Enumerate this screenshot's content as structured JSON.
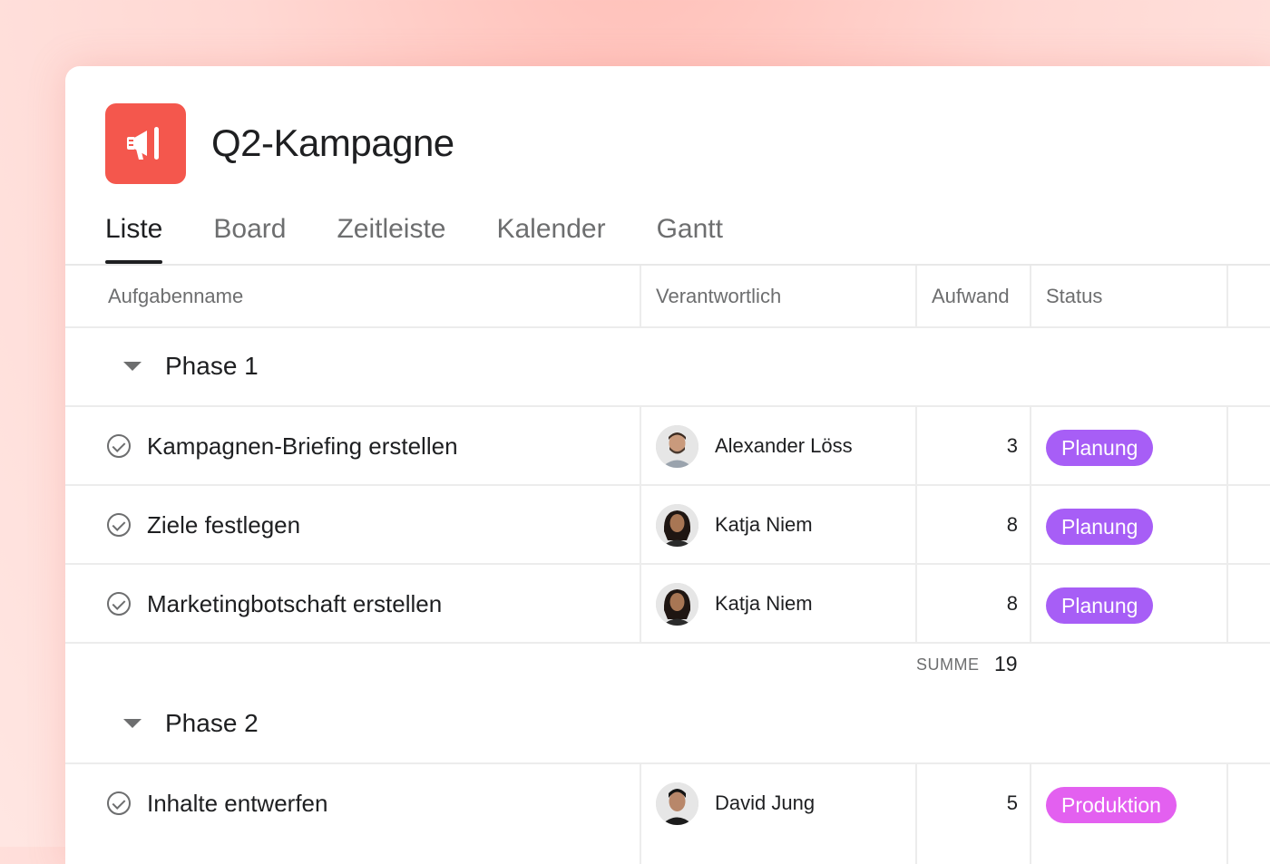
{
  "project": {
    "title": "Q2-Kampagne",
    "icon": "megaphone-icon",
    "icon_color": "#f4574d"
  },
  "tabs": [
    {
      "label": "Liste",
      "active": true
    },
    {
      "label": "Board",
      "active": false
    },
    {
      "label": "Zeitleiste",
      "active": false
    },
    {
      "label": "Kalender",
      "active": false
    },
    {
      "label": "Gantt",
      "active": false
    }
  ],
  "columns": {
    "task": "Aufgabenname",
    "assignee": "Verantwortlich",
    "effort": "Aufwand",
    "status": "Status"
  },
  "sections": [
    {
      "title": "Phase 1",
      "tasks": [
        {
          "name": "Kampagnen-Briefing erstellen",
          "assignee": "Alexander Löss",
          "effort": "3",
          "status": "Planung"
        },
        {
          "name": "Ziele festlegen",
          "assignee": "Katja Niem",
          "effort": "8",
          "status": "Planung"
        },
        {
          "name": "Marketingbotschaft erstellen",
          "assignee": "Katja Niem",
          "effort": "8",
          "status": "Planung"
        }
      ],
      "sum_label": "SUMME",
      "sum_value": "19"
    },
    {
      "title": "Phase 2",
      "tasks": [
        {
          "name": "Inhalte entwerfen",
          "assignee": "David Jung",
          "effort": "5",
          "status": "Produktion"
        }
      ]
    }
  ],
  "status_colors": {
    "Planung": "#a75ef6",
    "Produktion": "#e360f0"
  }
}
